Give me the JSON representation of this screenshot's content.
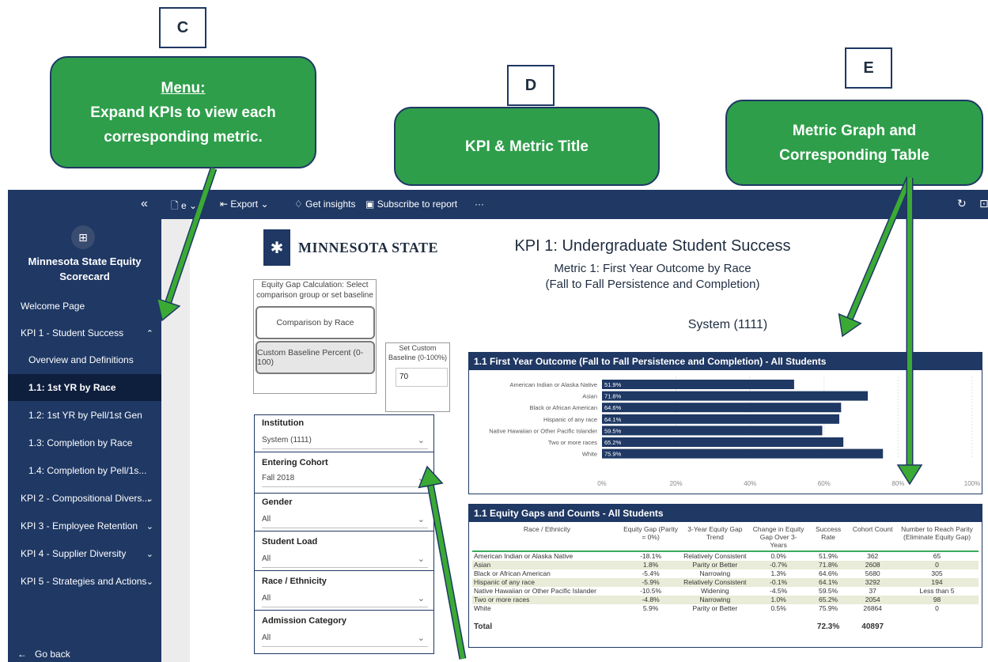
{
  "annotations": {
    "letters": {
      "c": "C",
      "d": "D",
      "e": "E"
    },
    "menu_callout": {
      "title": "Menu:",
      "line1": "Expand KPIs to view each",
      "line2": "corresponding metric."
    },
    "title_callout": {
      "text": "KPI & Metric Title"
    },
    "graph_callout": {
      "line1": "Metric Graph and",
      "line2": "Corresponding Table"
    },
    "arrow_color": "#3aaa35"
  },
  "toolbar": {
    "collapse_glyph": "«",
    "file_fragment": "e",
    "export_label": "Export",
    "insights_label": "Get insights",
    "subscribe_label": "Subscribe to report",
    "more_label": "···"
  },
  "sidebar": {
    "app_title_line1": "Minnesota State Equity",
    "app_title_line2": "Scorecard",
    "items": [
      {
        "label": "Welcome Page"
      },
      {
        "label": "KPI 1 - Student Success",
        "chevron": "^"
      },
      {
        "label": "Overview and Definitions"
      },
      {
        "label": "1.1: 1st YR by Race",
        "active": true
      },
      {
        "label": "1.2: 1st YR by Pell/1st Gen"
      },
      {
        "label": "1.3: Completion by Race"
      },
      {
        "label": "1.4: Completion by Pell/1s..."
      },
      {
        "label": "KPI 2 - Compositional Divers...",
        "chevron": "v"
      },
      {
        "label": "KPI 3 - Employee Retention",
        "chevron": "v"
      },
      {
        "label": "KPI 4 - Supplier Diversity",
        "chevron": "v"
      },
      {
        "label": "KPI 5 - Strategies and Actions",
        "chevron": "v"
      }
    ],
    "go_back": "Go back"
  },
  "report": {
    "logo_text": "MINNESOTA STATE",
    "kpi_title": "KPI 1: Undergraduate Student Success",
    "metric_line1": "Metric 1:  First Year Outcome by Race",
    "metric_line2": "(Fall to Fall Persistence and Completion)",
    "system_label": "System (1111)",
    "equity_gap": {
      "title": "Equity Gap Calculation: Select comparison group or set baseline",
      "option1": "Comparison by Race",
      "option2": "Custom Baseline Percent (0-100)",
      "baseline_label": "Set Custom Baseline (0-100%)",
      "baseline_value": "70"
    },
    "slicers": [
      {
        "label": "Institution",
        "value": "System (1111)"
      },
      {
        "label": "Entering Cohort",
        "value": "Fall 2018"
      },
      {
        "label": "Gender",
        "value": "All"
      },
      {
        "label": "Student Load",
        "value": "All"
      },
      {
        "label": "Race / Ethnicity",
        "value": "All"
      },
      {
        "label": "Admission Category",
        "value": "All"
      }
    ]
  },
  "chart_data": {
    "type": "bar",
    "orientation": "horizontal",
    "title": "1.1 First Year Outcome (Fall to Fall Persistence and Completion) - All Students",
    "categories": [
      "American Indian or Alaska Native",
      "Asian",
      "Black or African American",
      "Hispanic of any race",
      "Native Hawaiian or Other Pacific Islander",
      "Two or more races",
      "White"
    ],
    "values": [
      51.9,
      71.8,
      64.6,
      64.1,
      59.5,
      65.2,
      75.9
    ],
    "data_labels": [
      "51.9%",
      "71.8%",
      "64.6%",
      "64.1%",
      "59.5%",
      "65.2%",
      "75.9%"
    ],
    "xlim": [
      0,
      100
    ],
    "x_ticks": [
      "0%",
      "20%",
      "40%",
      "60%",
      "80%",
      "100%"
    ],
    "grid": true,
    "bar_color": "#1f3864"
  },
  "table": {
    "title": "1.1 Equity Gaps and Counts - All Students",
    "headers": [
      "Race / Ethnicity",
      "Equity Gap (Parity = 0%)",
      "3-Year Equity Gap Trend",
      "Change in Equity Gap Over 3-Years",
      "Success Rate",
      "Cohort Count",
      "Number to Reach Parity (Eliminate Equity Gap)"
    ],
    "rows": [
      [
        "American Indian or Alaska Native",
        "-18.1%",
        "Relatively Consistent",
        "0.0%",
        "51.9%",
        "362",
        "65"
      ],
      [
        "Asian",
        "1.8%",
        "Parity or Better",
        "-0.7%",
        "71.8%",
        "2608",
        "0"
      ],
      [
        "Black or African American",
        "-5.4%",
        "Narrowing",
        "1.3%",
        "64.6%",
        "5680",
        "305"
      ],
      [
        "Hispanic of any race",
        "-5.9%",
        "Relatively Consistent",
        "-0.1%",
        "64.1%",
        "3292",
        "194"
      ],
      [
        "Native Hawaiian or Other Pacific Islander",
        "-10.5%",
        "Widening",
        "-4.5%",
        "59.5%",
        "37",
        "Less than 5"
      ],
      [
        "Two or more races",
        "-4.8%",
        "Narrowing",
        "1.0%",
        "65.2%",
        "2054",
        "98"
      ],
      [
        "White",
        "5.9%",
        "Parity or Better",
        "0.5%",
        "75.9%",
        "26864",
        "0"
      ]
    ],
    "total": {
      "label": "Total",
      "success_rate": "72.3%",
      "cohort_count": "40897"
    }
  }
}
